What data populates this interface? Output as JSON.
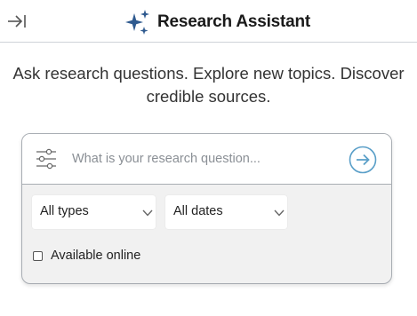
{
  "header": {
    "title": "Research Assistant",
    "collapse_icon": "collapse-panel-icon",
    "brand_icon": "sparkle-icon",
    "brand_color": "#2f5a8f"
  },
  "intro": {
    "text": "Ask research questions. Explore new topics. Discover credible sources."
  },
  "search": {
    "placeholder": "What is your research question...",
    "value": "",
    "filter_icon": "sliders-icon",
    "submit_icon": "arrow-right-circle-icon",
    "submit_color": "#5a9fc8"
  },
  "filters": {
    "type_select": {
      "selected": "All types"
    },
    "date_select": {
      "selected": "All dates"
    },
    "available_online": {
      "label": "Available online",
      "checked": false
    }
  }
}
